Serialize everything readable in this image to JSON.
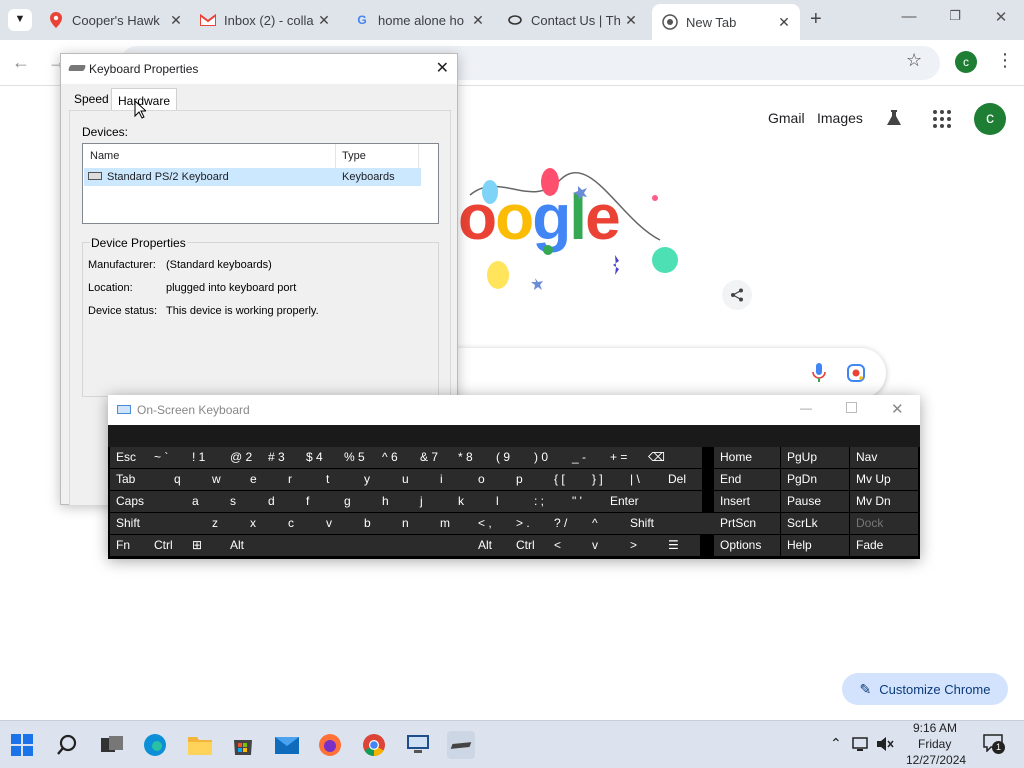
{
  "browser": {
    "tabs": [
      {
        "label": "Cooper's Hawk",
        "icon": "maps-pin-icon"
      },
      {
        "label": "Inbox (2) - colla",
        "icon": "gmail-icon"
      },
      {
        "label": "home alone ho",
        "icon": "google-g-icon"
      },
      {
        "label": "Contact Us | Th",
        "icon": "globe-icon"
      },
      {
        "label": "New Tab",
        "icon": "chrome-icon"
      }
    ],
    "new_tab_symbol": "+",
    "profile_initial": "c",
    "colors": {
      "strip": "#dfe3ea",
      "profile": "#1e7e34"
    }
  },
  "newtab": {
    "gmail": "Gmail",
    "images": "Images",
    "avatar_initial": "c",
    "customize": "Customize Chrome",
    "logo_letters": [
      "o",
      "o",
      "g",
      "l",
      "e"
    ]
  },
  "kbprops": {
    "title": "Keyboard Properties",
    "tabs": [
      "Speed",
      "Hardware"
    ],
    "devices_label": "Devices:",
    "columns": [
      "Name",
      "Type"
    ],
    "device_row": {
      "name": "Standard PS/2 Keyboard",
      "type": "Keyboards"
    },
    "device_props_label": "Device Properties",
    "props": [
      {
        "k": "Manufacturer:",
        "v": "(Standard keyboards)"
      },
      {
        "k": "Location:",
        "v": "plugged into keyboard port"
      },
      {
        "k": "Device status:",
        "v": "This device is working properly."
      }
    ]
  },
  "osk": {
    "title": "On-Screen Keyboard",
    "row1": [
      "Esc",
      "~ `",
      "! 1",
      "@ 2",
      "# 3",
      "$ 4",
      "% 5",
      "^ 6",
      "& 7",
      "* 8",
      "( 9",
      ") 0",
      "_ -",
      "+ =",
      "⌫"
    ],
    "row2": [
      "Tab",
      "q",
      "w",
      "e",
      "r",
      "t",
      "y",
      "u",
      "i",
      "o",
      "p",
      "{ [",
      "} ]",
      "| \\",
      "Del"
    ],
    "row3": [
      "Caps",
      "a",
      "s",
      "d",
      "f",
      "g",
      "h",
      "j",
      "k",
      "l",
      ": ;",
      "\" '",
      "Enter"
    ],
    "row4": [
      "Shift",
      "z",
      "x",
      "c",
      "v",
      "b",
      "n",
      "m",
      "< ,",
      "> .",
      "? /",
      "^",
      "Shift"
    ],
    "row5": [
      "Fn",
      "Ctrl",
      "⊞",
      "Alt",
      "",
      "Alt",
      "Ctrl",
      "<",
      "v",
      ">",
      "☰"
    ],
    "nav": [
      [
        "Home",
        "PgUp",
        "Nav"
      ],
      [
        "End",
        "PgDn",
        "Mv Up"
      ],
      [
        "Insert",
        "Pause",
        "Mv Dn"
      ],
      [
        "PrtScn",
        "ScrLk",
        "Dock"
      ],
      [
        "Options",
        "Help",
        "Fade"
      ]
    ]
  },
  "taskbar": {
    "time": "9:16 AM",
    "day": "Friday",
    "date": "12/27/2024",
    "notif_count": "1"
  }
}
